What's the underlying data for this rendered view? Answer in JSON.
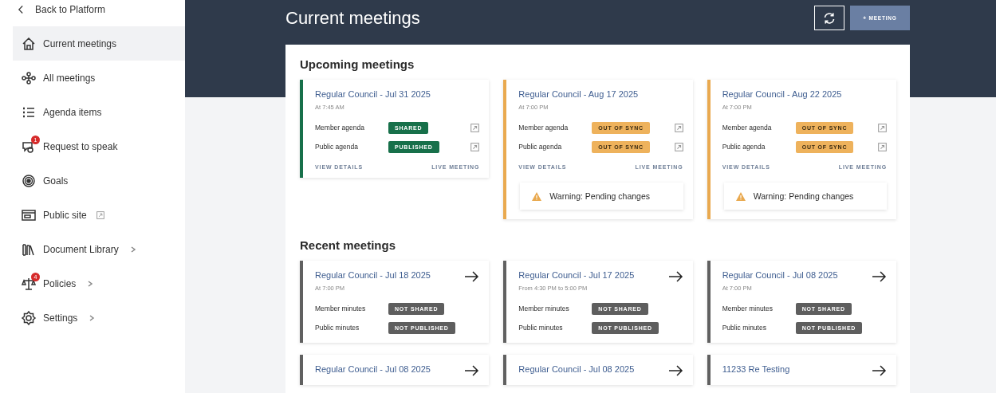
{
  "sidebar": {
    "back_link": {
      "label": "Back to Platform"
    },
    "items": [
      {
        "label": "Current meetings",
        "selected": true
      },
      {
        "label": "All meetings",
        "selected": false
      },
      {
        "label": "Agenda items",
        "selected": false
      },
      {
        "label": "Request to speak",
        "selected": false,
        "badge": "1"
      },
      {
        "label": "Goals",
        "selected": false
      },
      {
        "label": "Public site",
        "selected": false,
        "external": true
      },
      {
        "label": "Document Library",
        "selected": false,
        "submenu": true
      },
      {
        "label": "Policies",
        "selected": false,
        "badge": "4",
        "submenu": true
      },
      {
        "label": "Settings",
        "selected": false,
        "submenu": true
      }
    ]
  },
  "header": {
    "title": "Current meetings",
    "new_meeting_button": "+ MEETING"
  },
  "upcoming": {
    "heading": "Upcoming meetings",
    "cards": [
      {
        "kind": "synced",
        "title": "Regular Council - Jul 31 2025",
        "time": "At 7:45 AM",
        "rows": [
          {
            "label": "Member agenda",
            "badge": {
              "label": "SHARED",
              "kind": "success"
            }
          },
          {
            "label": "Public agenda",
            "badge": {
              "label": "PUBLISHED",
              "kind": "success"
            }
          }
        ],
        "actions": [
          "VIEW DETAILS",
          "LIVE MEETING"
        ]
      },
      {
        "kind": "pending",
        "title": "Regular Council - Aug 17 2025",
        "time": "At 7:00 PM",
        "rows": [
          {
            "label": "Member agenda",
            "badge": {
              "label": "OUT OF SYNC",
              "kind": "warning"
            }
          },
          {
            "label": "Public agenda",
            "badge": {
              "label": "OUT OF SYNC",
              "kind": "warning"
            }
          }
        ],
        "actions": [
          "VIEW DETAILS",
          "LIVE MEETING"
        ],
        "warning": "Warning: Pending changes"
      },
      {
        "kind": "pending",
        "title": "Regular Council - Aug 22 2025",
        "time": "At 7:00 PM",
        "rows": [
          {
            "label": "Member agenda",
            "badge": {
              "label": "OUT OF SYNC",
              "kind": "warning"
            }
          },
          {
            "label": "Public agenda",
            "badge": {
              "label": "OUT OF SYNC",
              "kind": "warning"
            }
          }
        ],
        "actions": [
          "VIEW DETAILS",
          "LIVE MEETING"
        ],
        "warning": "Warning: Pending changes"
      }
    ]
  },
  "recent": {
    "heading": "Recent meetings",
    "cards": [
      {
        "kind": "past",
        "title": "Regular Council - Jul 18 2025",
        "time": "At 7:00 PM",
        "rows": [
          {
            "label": "Member minutes",
            "badge": {
              "label": "NOT SHARED",
              "kind": "neutral"
            }
          },
          {
            "label": "Public minutes",
            "badge": {
              "label": "NOT PUBLISHED",
              "kind": "neutral"
            }
          }
        ]
      },
      {
        "kind": "past",
        "title": "Regular Council - Jul 17 2025",
        "time": "From 4:30 PM to 5:00 PM",
        "rows": [
          {
            "label": "Member minutes",
            "badge": {
              "label": "NOT SHARED",
              "kind": "neutral"
            }
          },
          {
            "label": "Public minutes",
            "badge": {
              "label": "NOT PUBLISHED",
              "kind": "neutral"
            }
          }
        ]
      },
      {
        "kind": "past",
        "title": "Regular Council - Jul 08 2025",
        "time": "At 7:00 PM",
        "rows": [
          {
            "label": "Member minutes",
            "badge": {
              "label": "NOT SHARED",
              "kind": "neutral"
            }
          },
          {
            "label": "Public minutes",
            "badge": {
              "label": "NOT PUBLISHED",
              "kind": "neutral"
            }
          }
        ]
      },
      {
        "kind": "past",
        "title": "Regular Council - Jul 08 2025"
      },
      {
        "kind": "past",
        "title": "Regular Council - Jul 08 2025"
      },
      {
        "kind": "past",
        "title": "11233 Re Testing"
      }
    ]
  }
}
